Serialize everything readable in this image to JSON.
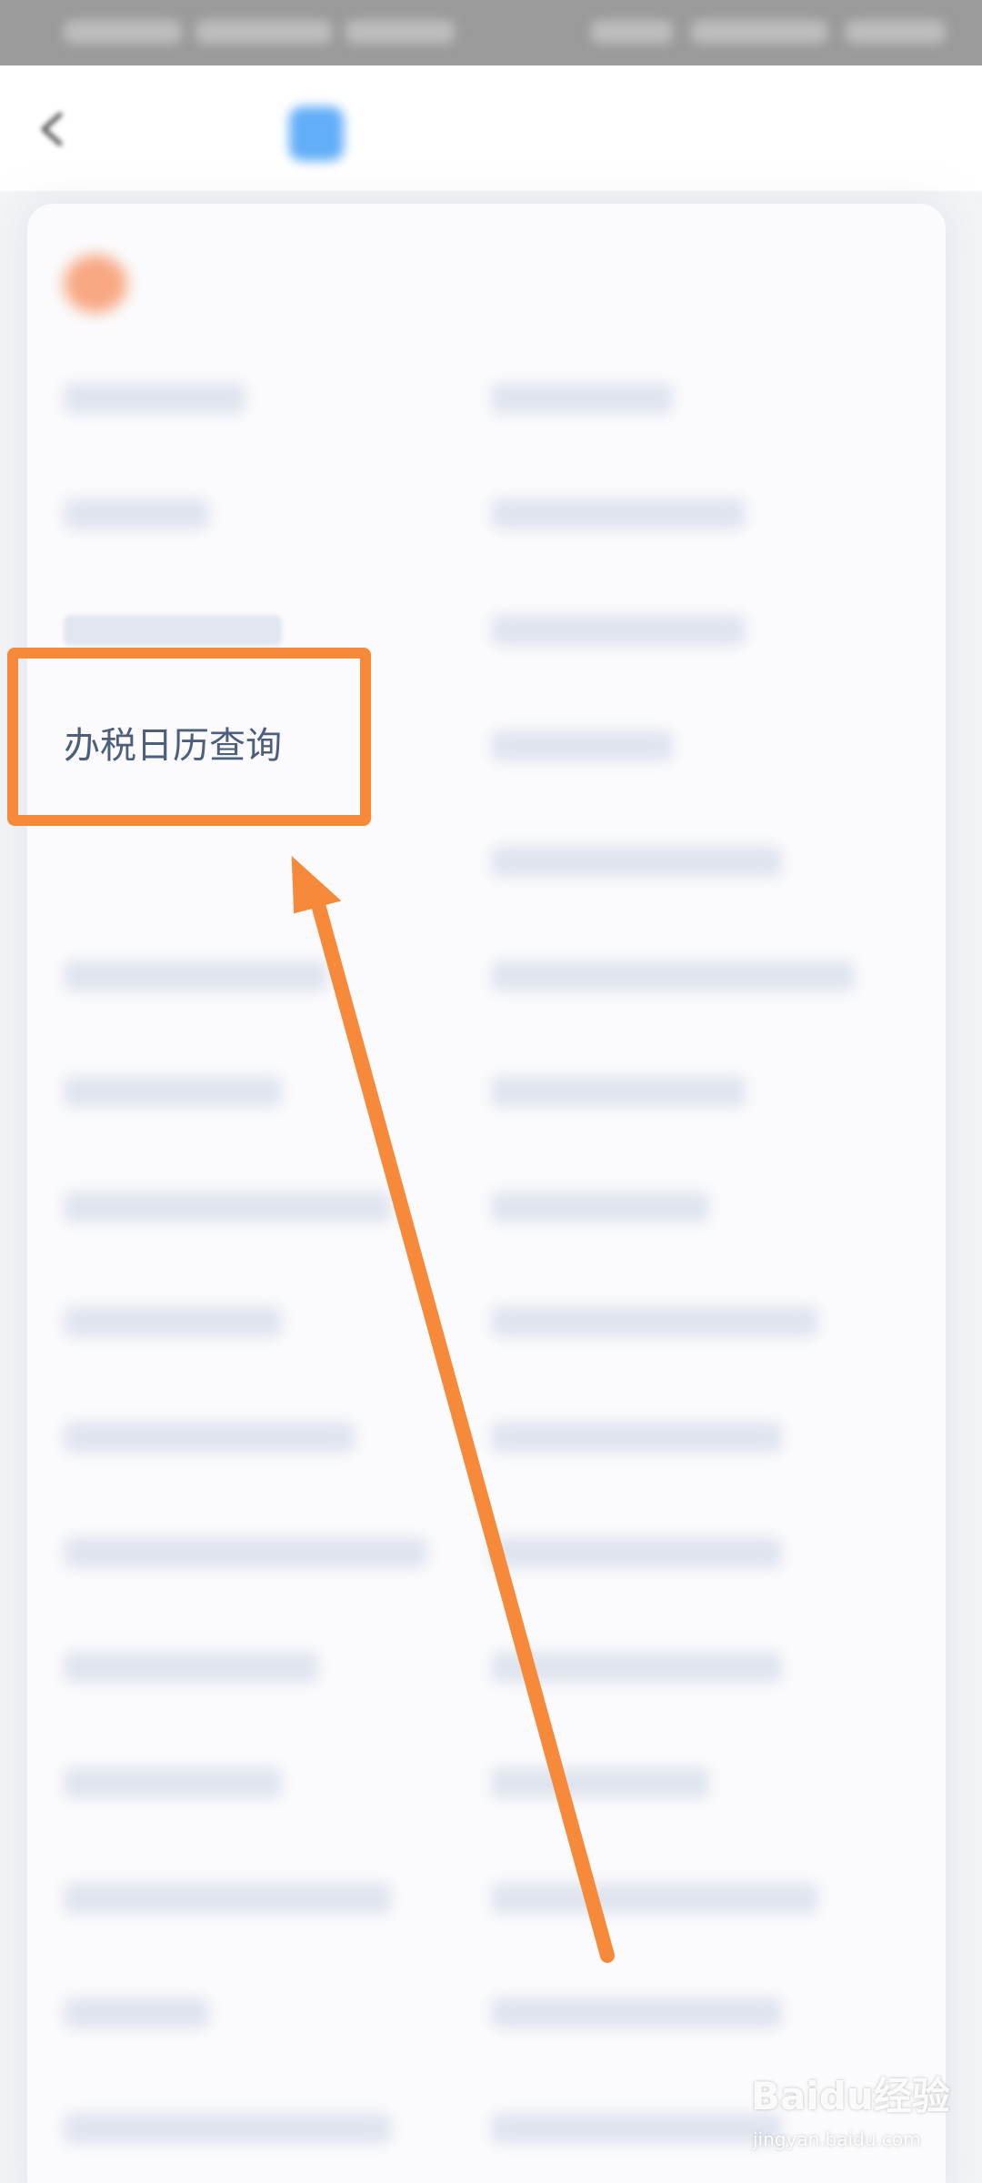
{
  "header": {
    "title": "",
    "back_icon": "chevron-left-icon",
    "logo_icon": "service-logo-icon",
    "logo_color": "#63aef8"
  },
  "section": {
    "title": "",
    "icon": "section-icon",
    "icon_color": "#f8a882"
  },
  "grid": {
    "left": [
      {
        "label": ""
      },
      {
        "label": ""
      },
      {
        "label": ""
      },
      {
        "label": "办税日历查询"
      },
      {
        "label": ""
      },
      {
        "label": ""
      },
      {
        "label": ""
      },
      {
        "label": ""
      },
      {
        "label": ""
      },
      {
        "label": ""
      },
      {
        "label": ""
      },
      {
        "label": ""
      },
      {
        "label": ""
      },
      {
        "label": ""
      },
      {
        "label": ""
      },
      {
        "label": ""
      }
    ],
    "right": [
      {
        "label": ""
      },
      {
        "label": ""
      },
      {
        "label": ""
      },
      {
        "label": ""
      },
      {
        "label": ""
      },
      {
        "label": ""
      },
      {
        "label": ""
      },
      {
        "label": ""
      },
      {
        "label": ""
      },
      {
        "label": ""
      },
      {
        "label": ""
      },
      {
        "label": ""
      },
      {
        "label": ""
      },
      {
        "label": ""
      },
      {
        "label": ""
      },
      {
        "label": ""
      }
    ]
  },
  "annotation": {
    "highlight_color": "#f6893a",
    "arrow_color": "#f6893a"
  },
  "watermark": {
    "brand": "Baidu经验",
    "url": "jingyan.baidu.com"
  }
}
